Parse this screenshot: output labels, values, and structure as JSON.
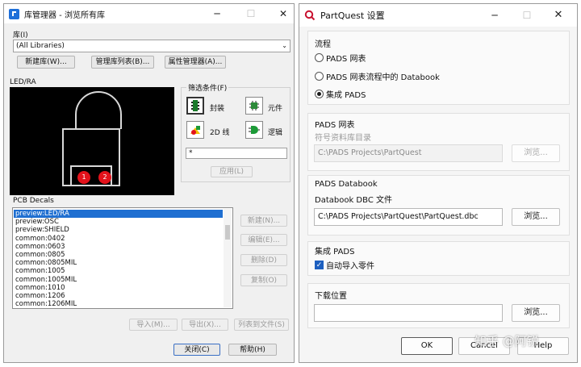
{
  "library_manager": {
    "title": "库管理器 - 浏览所有库",
    "library_label": "库(I)",
    "library_select_value": "(All Libraries)",
    "buttons": {
      "new_library": "新建库(W)...",
      "manage_list": "管理库列表(B)...",
      "attribute_manager": "属性管理器(A)..."
    },
    "preview_label": "LED/RA",
    "filter": {
      "label": "筛选条件(F)",
      "items": [
        "封装",
        "元件",
        "2D 线",
        "逻辑"
      ],
      "pattern_value": "*",
      "apply": "应用(L)"
    },
    "decals": {
      "label": "PCB Decals",
      "items": [
        "preview:LED/RA",
        "preview:OSC",
        "preview:SHIELD",
        "common:0402",
        "common:0603",
        "common:0805",
        "common:0805MIL",
        "common:1005",
        "common:1005MIL",
        "common:1010",
        "common:1206",
        "common:1206MIL"
      ],
      "selected_index": 0,
      "side_buttons": [
        "新建(N)...",
        "编辑(E)...",
        "删除(D)",
        "复制(O)"
      ]
    },
    "bottom_buttons": [
      "导入(M)...",
      "导出(X)...",
      "列表到文件(S)"
    ],
    "close": "关闭(C)",
    "help": "帮助(H)",
    "pin_labels": [
      "1",
      "2"
    ],
    "colors": {
      "pad": "#e3121b",
      "outline": "#d8d8d8",
      "selection": "#1f6fd1"
    }
  },
  "partquest": {
    "title": "PartQuest 设置",
    "flow": {
      "heading": "流程",
      "options": [
        "PADS 网表",
        "PADS 网表流程中的 Databook",
        "集成 PADS"
      ],
      "selected_index": 2
    },
    "netlist": {
      "heading": "PADS 网表",
      "sublabel": "符号资料库目录",
      "path": "C:\\PADS Projects\\PartQuest",
      "browse": "浏览..."
    },
    "databook": {
      "heading": "PADS Databook",
      "sublabel": "Databook DBC 文件",
      "path": "C:\\PADS Projects\\PartQuest\\PartQuest.dbc",
      "browse": "浏览..."
    },
    "integrated": {
      "heading": "集成 PADS",
      "checkbox_label": "自动导入零件",
      "checked": true
    },
    "download": {
      "heading": "下载位置",
      "path": "",
      "browse": "浏览..."
    },
    "ok": "OK",
    "cancel": "Cancel",
    "help": "Help"
  },
  "watermark": "知乎 @阿锐"
}
